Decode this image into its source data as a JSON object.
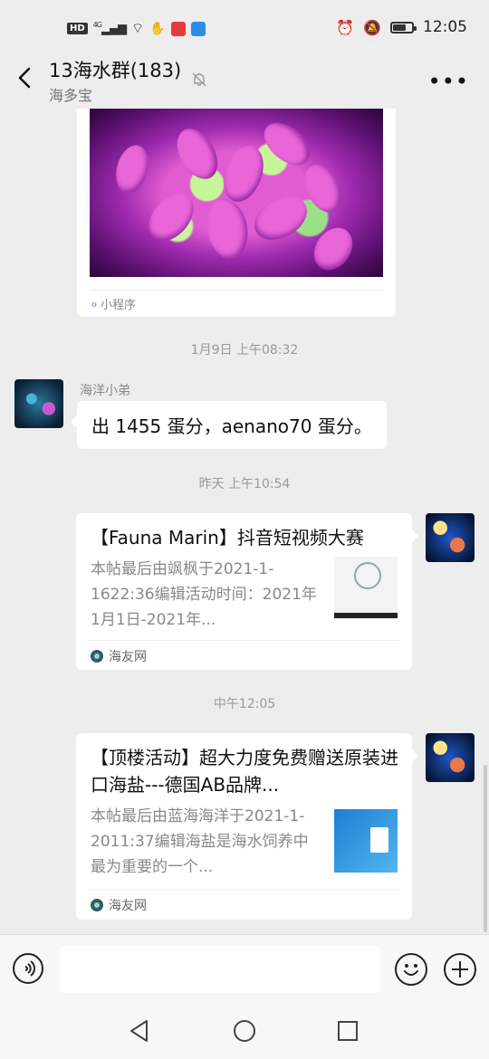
{
  "status_bar": {
    "hd": "HD",
    "network": "4G",
    "time": "12:05",
    "battery_level": 0.75
  },
  "header": {
    "title": "13海水群(183)",
    "subtitle": "海多宝"
  },
  "messages": {
    "miniprogram_label": "小程序",
    "time1": "1月9日 上午08:32",
    "sender1": "海洋小弟",
    "text1": "出 1455 蛋分，aenano70 蛋分。",
    "time2": "昨天 上午10:54",
    "card1": {
      "title": "【Fauna Marin】抖音短视频大赛",
      "desc": "本帖最后由飒枫于2021-1-1622:36编辑活动时间：2021年1月1日-2021年...",
      "source": "海友网"
    },
    "time3": "中午12:05",
    "card2": {
      "title": "【顶楼活动】超大力度免费赠送原装进口海盐---德国AB品牌...",
      "desc": "本帖最后由蓝海海洋于2021-1-2011:37编辑海盐是海水饲养中最为重要的一个...",
      "source": "海友网"
    }
  },
  "input": {
    "placeholder": ""
  },
  "colors": {
    "background": "#ededed",
    "bubble": "#ffffff",
    "timestamp": "#999999"
  }
}
